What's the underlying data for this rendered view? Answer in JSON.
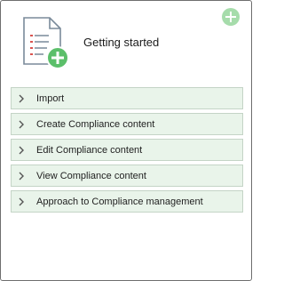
{
  "header": {
    "title": "Getting started",
    "add_icon": "plus-circle-icon",
    "document_icon": "document-add-icon"
  },
  "menu": {
    "items": [
      {
        "label": "Import"
      },
      {
        "label": "Create Compliance content"
      },
      {
        "label": "Edit Compliance content"
      },
      {
        "label": "View Compliance content"
      },
      {
        "label": "Approach to Compliance management"
      }
    ]
  },
  "colors": {
    "accent_green": "#5bbf6a",
    "light_green": "#a6dcab",
    "item_bg": "#e9f4ea",
    "item_border": "#c4d4c6",
    "doc_lines": "#d9534f"
  }
}
